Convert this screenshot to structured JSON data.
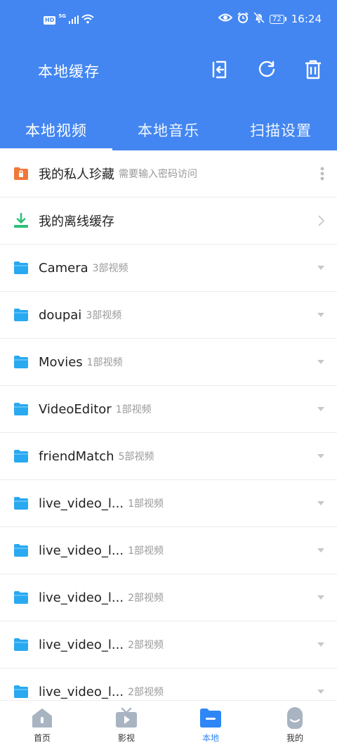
{
  "status_bar": {
    "hd": "HD",
    "network": "5G",
    "battery": "72",
    "time": "16:24"
  },
  "toolbar": {
    "title": "本地缓存",
    "icons": [
      "import-icon",
      "refresh-icon",
      "trash-icon"
    ]
  },
  "tabs": [
    {
      "label": "本地视频",
      "active": true
    },
    {
      "label": "本地音乐",
      "active": false
    },
    {
      "label": "扫描设置",
      "active": false
    }
  ],
  "special_rows": [
    {
      "title": "我的私人珍藏",
      "subtitle": "需要输入密码访问",
      "icon": "lock-folder-icon",
      "right": "more-vert-icon"
    },
    {
      "title": "我的离线缓存",
      "subtitle": "",
      "icon": "download-icon",
      "right": "chevron-right-icon"
    }
  ],
  "folders": [
    {
      "name": "Camera",
      "count": "3部视频"
    },
    {
      "name": "doupai",
      "count": "3部视频"
    },
    {
      "name": "Movies",
      "count": "1部视频"
    },
    {
      "name": "VideoEditor",
      "count": "1部视频"
    },
    {
      "name": "friendMatch",
      "count": "5部视频"
    },
    {
      "name": "live_video_l...",
      "count": "1部视频"
    },
    {
      "name": "live_video_l...",
      "count": "1部视频"
    },
    {
      "name": "live_video_l...",
      "count": "2部视频"
    },
    {
      "name": "live_video_l...",
      "count": "2部视频"
    },
    {
      "name": "live_video_l...",
      "count": "2部视频"
    }
  ],
  "bottom_nav": [
    {
      "label": "首页",
      "icon": "home-icon",
      "active": false
    },
    {
      "label": "影视",
      "icon": "tv-icon",
      "active": false
    },
    {
      "label": "本地",
      "icon": "local-folder-icon",
      "active": true
    },
    {
      "label": "我的",
      "icon": "profile-icon",
      "active": false
    }
  ],
  "colors": {
    "header": "#4386f1",
    "folder": "#29a9f0",
    "private": "#f07838",
    "download": "#2cc07a",
    "nav_active": "#2f86f6",
    "nav_inactive": "#a9b4c2"
  }
}
